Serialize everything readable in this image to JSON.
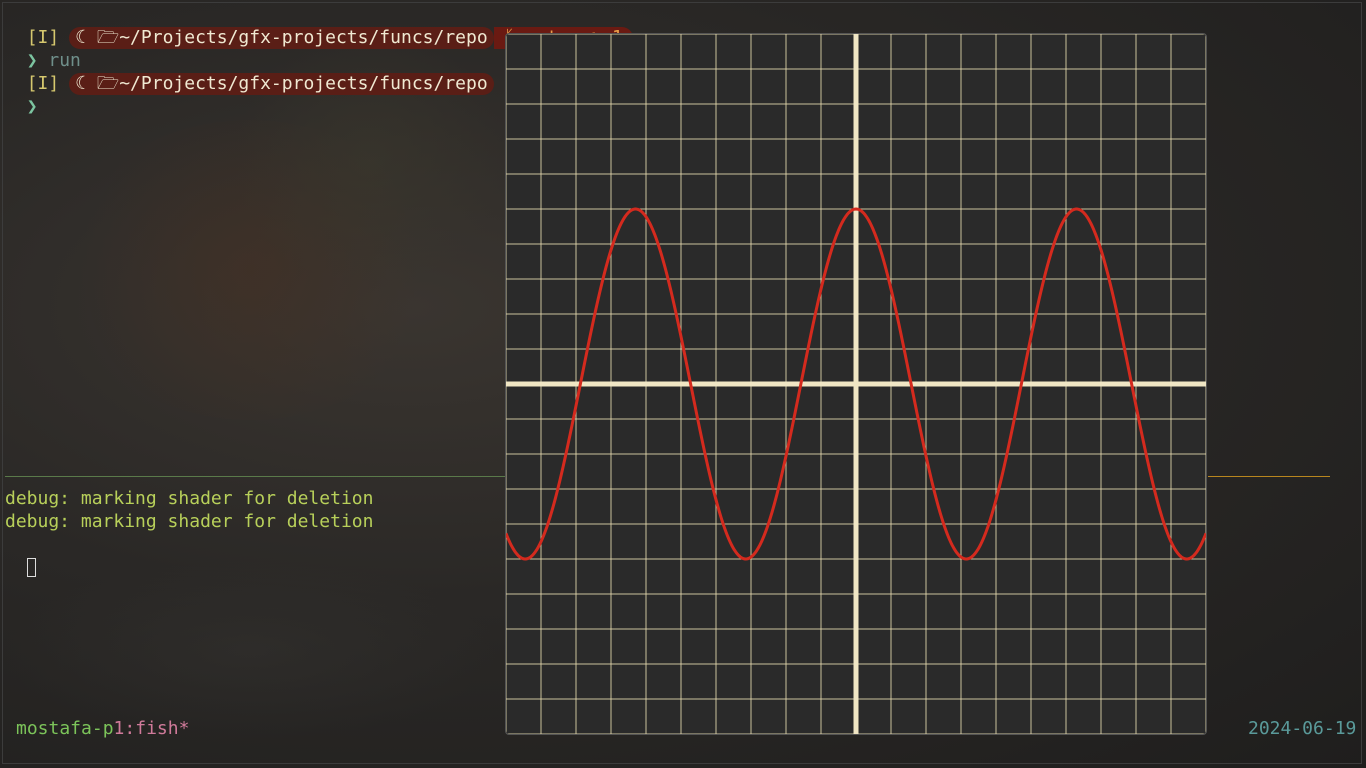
{
  "terminal": {
    "vi_mode": "[I]",
    "moon_icon": "crescent-moon-icon",
    "folder_icon": "folder-icon",
    "path": "~/Projects/gfx-projects/funcs/repo",
    "git": {
      "branch_icon": "git-branch-icon",
      "branch": "master",
      "edit_icon": "pencil-icon",
      "changes": "~1"
    },
    "prompt_char": "❯",
    "command": "run",
    "debug_lines": [
      "debug: marking shader for deletion",
      "debug: marking shader for deletion"
    ]
  },
  "statusbar": {
    "host": "mostafa-p",
    "window_index": "1",
    "window_name": ":fish*",
    "date": "2024-06-19"
  },
  "colors": {
    "grid": "#e8dcb0",
    "axis": "#f0e6c4",
    "curve": "#d42a1e",
    "plot_bg": "#2a2a2a"
  },
  "chart_data": {
    "type": "line",
    "title": "",
    "xlabel": "",
    "ylabel": "",
    "function": "cos",
    "grid": true,
    "xlim": [
      -10,
      10
    ],
    "ylim": [
      -10,
      10
    ],
    "grid_step": 1,
    "series": [
      {
        "x": [
          -10,
          -9.5,
          -9,
          -8.5,
          -8,
          -7.5,
          -7,
          -6.5,
          -6,
          -5.5,
          -5,
          -4.5,
          -4,
          -3.5,
          -3,
          -2.5,
          -2,
          -1.5,
          -1,
          -0.5,
          0,
          0.5,
          1,
          1.5,
          2,
          2.5,
          3,
          3.5,
          4,
          4.5,
          5,
          5.5,
          6,
          6.5,
          7,
          7.5,
          8,
          8.5,
          9,
          9.5,
          10
        ],
        "y": [
          -4.26,
          -4.99,
          -3.87,
          -2.36,
          -0.15,
          1.78,
          3.81,
          4.8,
          4.63,
          3.57,
          1.26,
          -0.64,
          -3.14,
          -4.62,
          -4.91,
          -3.61,
          -1.82,
          0.37,
          2.61,
          4.13,
          5,
          4.13,
          2.61,
          0.37,
          -1.82,
          -3.61,
          -4.91,
          -4.62,
          -3.14,
          -0.64,
          1.26,
          3.57,
          4.63,
          4.8,
          3.81,
          1.78,
          -0.15,
          -2.36,
          -3.87,
          -4.99,
          -4.26
        ]
      }
    ]
  }
}
